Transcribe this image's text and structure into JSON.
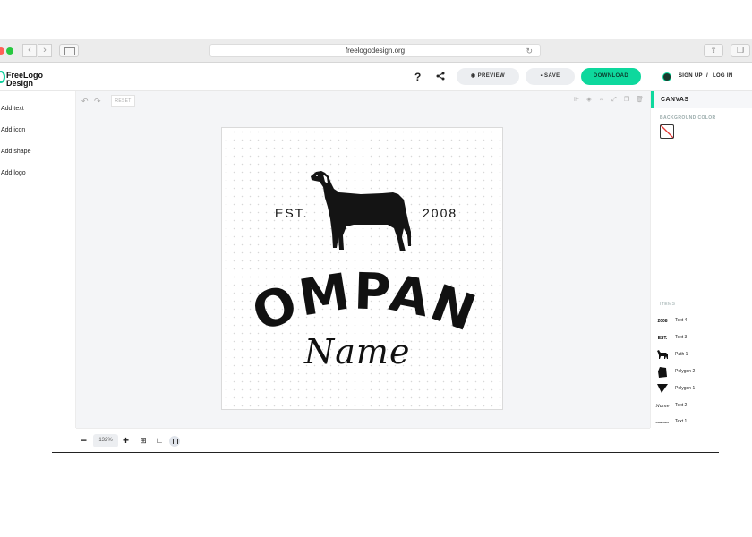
{
  "browser": {
    "url": "freelogodesign.org",
    "traffic_colors": [
      "#ff5f57",
      "#28c840"
    ],
    "back_icon": "chevron-left-icon",
    "forward_icon": "chevron-right-icon"
  },
  "app": {
    "logo_line1": "FreeLogo",
    "logo_line2": "Design",
    "help_icon": "?",
    "preview_label": "PREVIEW",
    "save_label": "SAVE",
    "download_label": "DOWNLOAD",
    "sign_up_label": "SIGN UP",
    "separator": "/",
    "log_in_label": "LOG IN",
    "accent_color": "#0ed89d"
  },
  "left_menu": {
    "items": [
      {
        "label": "Add text"
      },
      {
        "label": "Add icon"
      },
      {
        "label": "Add shape"
      },
      {
        "label": "Add logo"
      }
    ]
  },
  "toolbar": {
    "reset_label": "RESET"
  },
  "logo_design": {
    "est_label": "EST.",
    "year_label": "2008",
    "company_text": "COMPANY",
    "name_text": "Name"
  },
  "zoom": {
    "minus": "−",
    "value": "132%",
    "plus": "+"
  },
  "right_panel": {
    "title": "CANVAS",
    "background_color_label": "BACKGROUND COLOR",
    "items_label": "ITEMS",
    "items": [
      {
        "thumb": "2008",
        "label": "Text 4"
      },
      {
        "thumb": "EST.",
        "label": "Text 3"
      },
      {
        "thumb": "",
        "label": "Path 1"
      },
      {
        "thumb": "",
        "label": "Polygon 2"
      },
      {
        "thumb": "",
        "label": "Polygon 1"
      },
      {
        "thumb": "Name",
        "label": "Text 2"
      },
      {
        "thumb": "COMPANY",
        "label": "Text 1"
      }
    ]
  }
}
